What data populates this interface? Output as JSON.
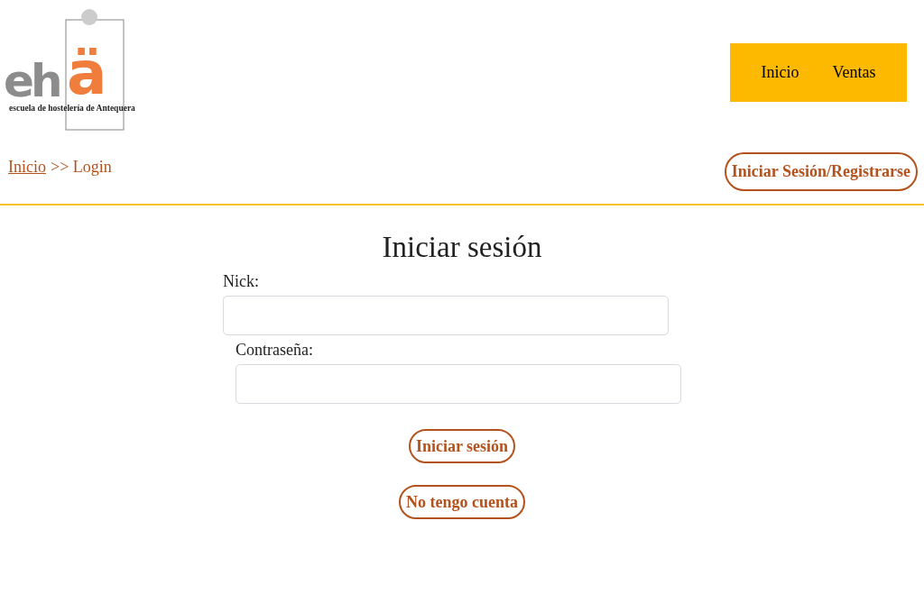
{
  "logo": {
    "mark_left": "eh",
    "mark_right": "ä",
    "tagline": "escuela de hostelería de Antequera"
  },
  "nav": [
    {
      "label": "Inicio"
    },
    {
      "label": "Ventas"
    }
  ],
  "breadcrumb": {
    "link": "Inicio",
    "rest": ">> Login"
  },
  "account_button": "Iniciar Sesión/Registrarse",
  "title": "Iniciar sesión",
  "fields": [
    {
      "label": "Nick:"
    },
    {
      "label": "Contraseña:"
    }
  ],
  "buttons": [
    "Iniciar sesión",
    "No tengo cuenta"
  ]
}
